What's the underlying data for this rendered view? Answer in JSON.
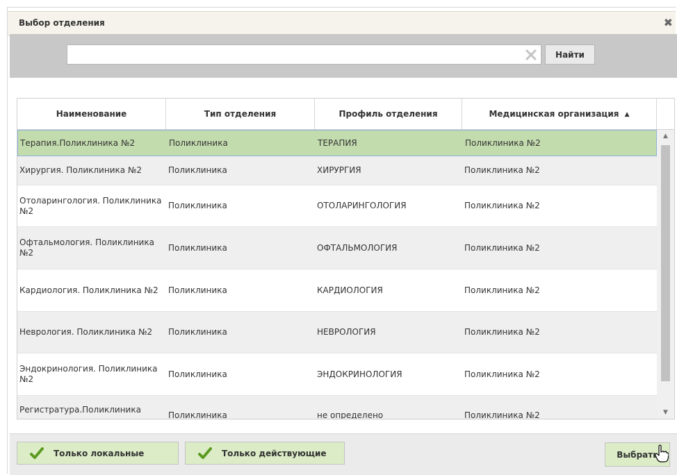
{
  "dialog": {
    "title": "Выбор отделения",
    "close_glyph": "✖"
  },
  "search": {
    "value": "",
    "placeholder": "",
    "find_label": "Найти"
  },
  "table": {
    "columns": [
      {
        "label": "Наименование"
      },
      {
        "label": "Тип отделения"
      },
      {
        "label": "Профиль отделения"
      },
      {
        "label": "Медицинская организация",
        "sort": "asc",
        "sort_glyph": "▲"
      }
    ],
    "rows": [
      {
        "name": "Терапия.Поликлиника №2",
        "type": "Поликлиника",
        "profile": "ТЕРАПИЯ",
        "org": "Поликлиника №2",
        "selected": true
      },
      {
        "name": "Хирургия. Поликлиника №2",
        "type": "Поликлиника",
        "profile": "ХИРУРГИЯ",
        "org": "Поликлиника №2"
      },
      {
        "name": "Отоларингология. Поликлиника №2",
        "type": "Поликлиника",
        "profile": "ОТОЛАРИНГОЛОГИЯ",
        "org": "Поликлиника №2"
      },
      {
        "name": "Офтальмология. Поликлиника №2",
        "type": "Поликлиника",
        "profile": "ОФТАЛЬМОЛОГИЯ",
        "org": "Поликлиника №2"
      },
      {
        "name": "Кардиология. Поликлиника №2",
        "type": "Поликлиника",
        "profile": "КАРДИОЛОГИЯ",
        "org": "Поликлиника №2"
      },
      {
        "name": "Неврология. Поликлиника №2",
        "type": "Поликлиника",
        "profile": "НЕВРОЛОГИЯ",
        "org": "Поликлиника №2"
      },
      {
        "name": "Эндокринология. Поликлиника №2",
        "type": "Поликлиника",
        "profile": "ЭНДОКРИНОЛОГИЯ",
        "org": "Поликлиника №2"
      },
      {
        "name": "Регистратура.Поликлиника",
        "type": "Поликлиника",
        "profile": "не определено",
        "org": "Поликлиника №2"
      }
    ],
    "scroll_up_glyph": "▲",
    "scroll_down_glyph": "▼"
  },
  "footer": {
    "local_only_label": "Только локальные",
    "active_only_label": "Только действующие",
    "choose_label": "Выбрать"
  },
  "colors": {
    "selected_row": "#c3dcae",
    "filter_button": "#dcecc7",
    "check_icon": "#5a9a1f"
  },
  "icons": {
    "clear": "clear-x-icon",
    "check": "checkmark-icon",
    "cursor": "hand-pointer-icon"
  }
}
